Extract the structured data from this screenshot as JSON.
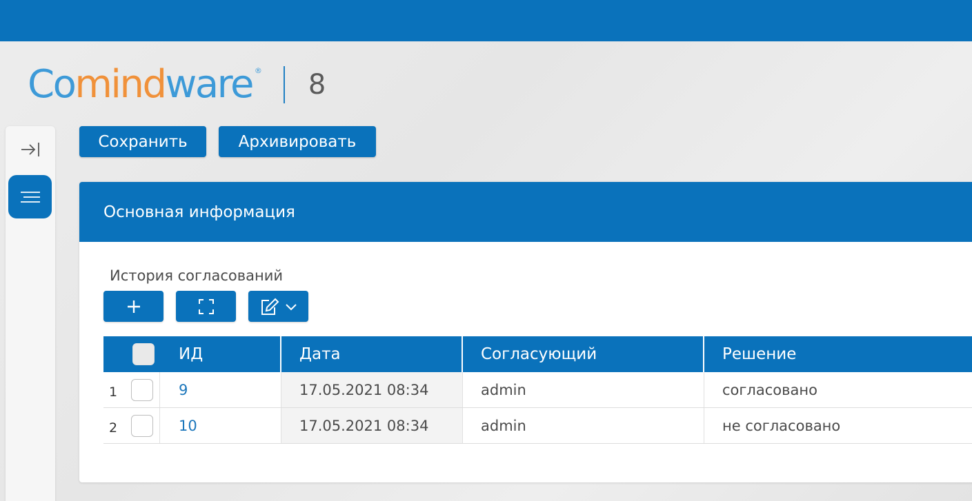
{
  "app": {
    "logo_parts": [
      "Co",
      "mind",
      "ware"
    ],
    "logo_mark": "®",
    "version": "8"
  },
  "toolbar": {
    "save_label": "Сохранить",
    "archive_label": "Архивировать"
  },
  "sidebar": {
    "collapse_icon": "collapse-right-icon",
    "menu_icon": "hamburger-menu-icon"
  },
  "card": {
    "title": "Основная информация",
    "section_title": "История согласований",
    "actions": [
      {
        "icon": "plus-icon"
      },
      {
        "icon": "expand-icon"
      },
      {
        "icon": "edit-icon",
        "dropdown": "chevron-down-icon"
      }
    ]
  },
  "table": {
    "columns": [
      "ИД",
      "Дата",
      "Согласующий",
      "Решение"
    ],
    "rows": [
      {
        "num": "1",
        "id": "9",
        "date": "17.05.2021 08:34",
        "approver": "admin",
        "decision": "согласовано"
      },
      {
        "num": "2",
        "id": "10",
        "date": "17.05.2021 08:34",
        "approver": "admin",
        "decision": "не согласовано"
      }
    ]
  },
  "colors": {
    "primary": "#0a72bb",
    "logo_blue": "#3d9ad8",
    "logo_orange": "#f0913a",
    "link": "#1b76bb"
  }
}
